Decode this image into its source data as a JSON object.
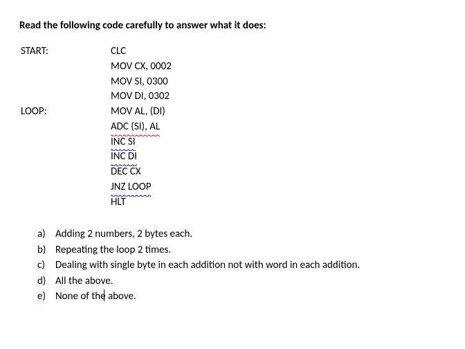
{
  "question_title": "Read the following code carefully to answer what it does:",
  "code": {
    "rows": [
      {
        "label": "START:",
        "instr": "CLC",
        "sq": ""
      },
      {
        "label": "",
        "instr": "MOV CX, 0002",
        "sq": ""
      },
      {
        "label": "",
        "instr": "MOV SI,  0300",
        "sq": ""
      },
      {
        "label": "",
        "instr": "MOV DI, 0302",
        "sq": ""
      },
      {
        "label": "LOOP:",
        "instr": "MOV AL, (DI)",
        "sq": ""
      },
      {
        "label": "",
        "instr": "ADC  (SI), AL",
        "sq": "red"
      },
      {
        "label": "",
        "instr": "INC  SI",
        "sq": "blue"
      },
      {
        "label": "",
        "instr": "INC  DI",
        "sq": "blue"
      },
      {
        "label": "",
        "instr": "DEC CX",
        "sq": ""
      },
      {
        "label": "",
        "instr": "JNZ  LOOP",
        "sq": "blue"
      },
      {
        "label": "",
        "instr": "HLT",
        "sq": ""
      }
    ]
  },
  "options": [
    {
      "letter": "a)",
      "text": "Adding 2 numbers, 2 bytes each."
    },
    {
      "letter": "b)",
      "text": "Repeating the loop 2 times."
    },
    {
      "letter": "c)",
      "text": "Dealing with single byte in each addition not with word in each addition."
    },
    {
      "letter": "d)",
      "text": "All the above."
    },
    {
      "letter": "e)",
      "text": "None of the above.",
      "cursor": true
    }
  ]
}
